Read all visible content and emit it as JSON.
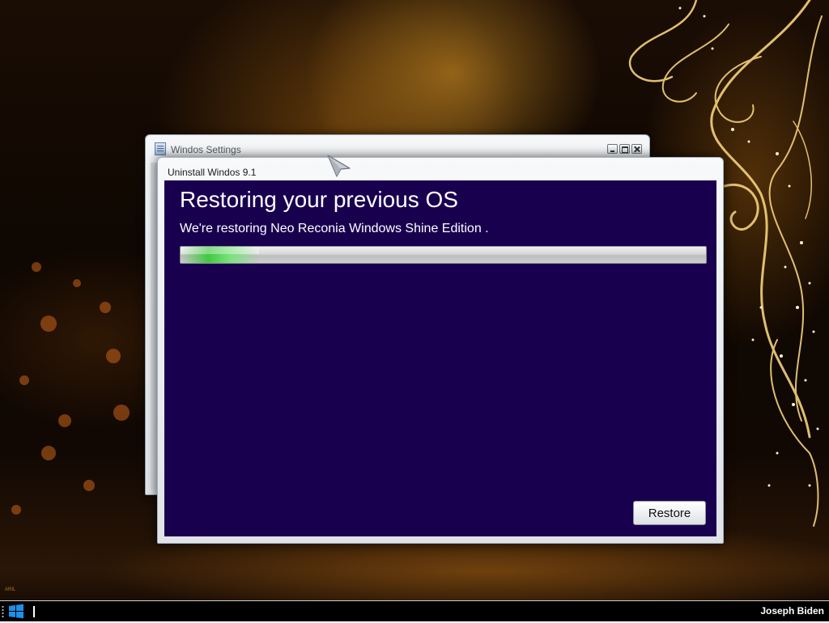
{
  "desktop": {
    "wallpaper_signature": "ARIL"
  },
  "back_window": {
    "title": "Windos Settings",
    "icon": "settings-document-icon"
  },
  "dialog": {
    "title": "Uninstall Windos 9.1",
    "heading": "Restoring your previous OS",
    "subtext": "We're restoring Neo Reconia Windows Shine Edition .",
    "progress_fraction": 0.15,
    "restore_label": "Restore",
    "accent_color": "#18004f"
  },
  "taskbar": {
    "start_icon": "windows-logo-icon",
    "user_name": "Joseph Biden"
  }
}
